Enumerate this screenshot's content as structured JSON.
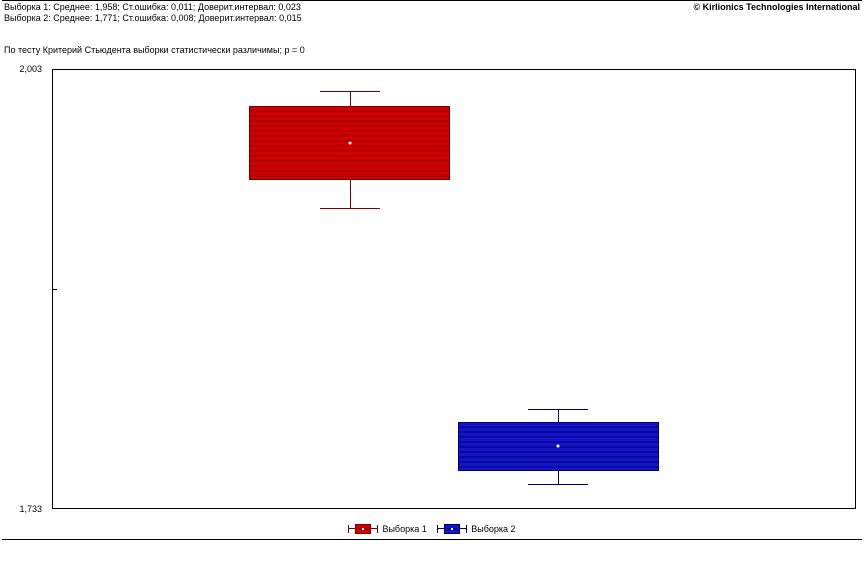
{
  "header": {
    "sample1_line": "Выборка 1: Среднее: 1,958; Ст.ошибка: 0,011; Доверит.интервал: 0,023",
    "sample2_line": "Выборка 2: Среднее: 1,771; Ст.ошибка: 0,008; Доверит.интервал: 0,015",
    "copyright": "© Kirlionics Technologies International"
  },
  "test_result": "По тесту Критерий Стьюдента выборки статистически различимы; p = 0",
  "axis": {
    "y_top": "2,003",
    "y_bottom": "1,733"
  },
  "legend": {
    "item1": "Выборка 1",
    "item2": "Выборка 2"
  },
  "chart_data": {
    "type": "boxplot",
    "title": "",
    "xlabel": "",
    "ylabel": "",
    "ylim": [
      1.733,
      2.003
    ],
    "series": [
      {
        "name": "Выборка 1",
        "color": "#d00000",
        "mean": 1.958,
        "std_err": 0.011,
        "conf_interval": 0.023,
        "box_low": 1.935,
        "box_high": 1.981,
        "whisker_low": 1.918,
        "whisker_high": 1.99
      },
      {
        "name": "Выборка 2",
        "color": "#1414c8",
        "mean": 1.771,
        "std_err": 0.008,
        "conf_interval": 0.015,
        "box_low": 1.756,
        "box_high": 1.786,
        "whisker_low": 1.748,
        "whisker_high": 1.794
      }
    ]
  }
}
